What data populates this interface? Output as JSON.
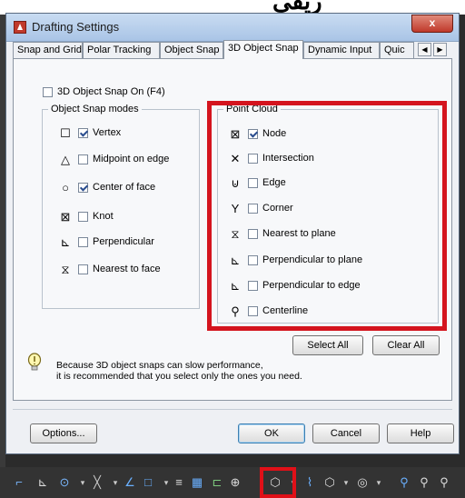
{
  "window": {
    "title": "Drafting Settings",
    "close_label": "x"
  },
  "tabs": [
    {
      "label": "Snap and Grid",
      "active": false
    },
    {
      "label": "Polar Tracking",
      "active": false
    },
    {
      "label": "Object Snap",
      "active": false
    },
    {
      "label": "3D Object Snap",
      "active": true
    },
    {
      "label": "Dynamic Input",
      "active": false
    },
    {
      "label": "Quic",
      "active": false
    }
  ],
  "tab_scroll": {
    "left": "◀",
    "right": "▶"
  },
  "snap_on": {
    "label": "3D Object Snap On (F4)",
    "checked": false
  },
  "object_snap_modes": {
    "title": "Object Snap modes",
    "items": [
      {
        "icon": "square-icon",
        "glyph": "☐",
        "label": "Vertex",
        "checked": true
      },
      {
        "icon": "triangle-icon",
        "glyph": "△",
        "label": "Midpoint on edge",
        "checked": false
      },
      {
        "icon": "circle-icon",
        "glyph": "○",
        "label": "Center of face",
        "checked": true
      },
      {
        "icon": "knot-icon",
        "glyph": "⊠",
        "label": "Knot",
        "checked": false
      },
      {
        "icon": "perpendicular-icon",
        "glyph": "⊾",
        "label": "Perpendicular",
        "checked": false
      },
      {
        "icon": "hourglass-icon",
        "glyph": "⧖",
        "label": "Nearest to face",
        "checked": false
      }
    ]
  },
  "point_cloud": {
    "title": "Point Cloud",
    "items": [
      {
        "icon": "node-icon",
        "glyph": "⊠",
        "label": "Node",
        "checked": true
      },
      {
        "icon": "intersection-icon",
        "glyph": "✕",
        "label": "Intersection",
        "checked": false
      },
      {
        "icon": "edge-icon",
        "glyph": "⊍",
        "label": "Edge",
        "checked": false
      },
      {
        "icon": "corner-icon",
        "glyph": "Y",
        "label": "Corner",
        "checked": false
      },
      {
        "icon": "nearest-plane-icon",
        "glyph": "⧖",
        "label": "Nearest to plane",
        "checked": false
      },
      {
        "icon": "perpendicular-plane-icon",
        "glyph": "⊾",
        "label": "Perpendicular to plane",
        "checked": false
      },
      {
        "icon": "perpendicular-edge-icon",
        "glyph": "⊾",
        "label": "Perpendicular to edge",
        "checked": false
      },
      {
        "icon": "centerline-icon",
        "glyph": "⚲",
        "label": "Centerline",
        "checked": false
      }
    ]
  },
  "buttons": {
    "select_all": "Select All",
    "clear_all": "Clear All",
    "options": "Options...",
    "ok": "OK",
    "cancel": "Cancel",
    "help": "Help"
  },
  "hint": {
    "line1": "Because 3D object snaps can slow performance,",
    "line2": "it is recommended that you select only the ones you need."
  },
  "colors": {
    "highlight": "#d4141e",
    "accent": "#2a4d8f"
  }
}
